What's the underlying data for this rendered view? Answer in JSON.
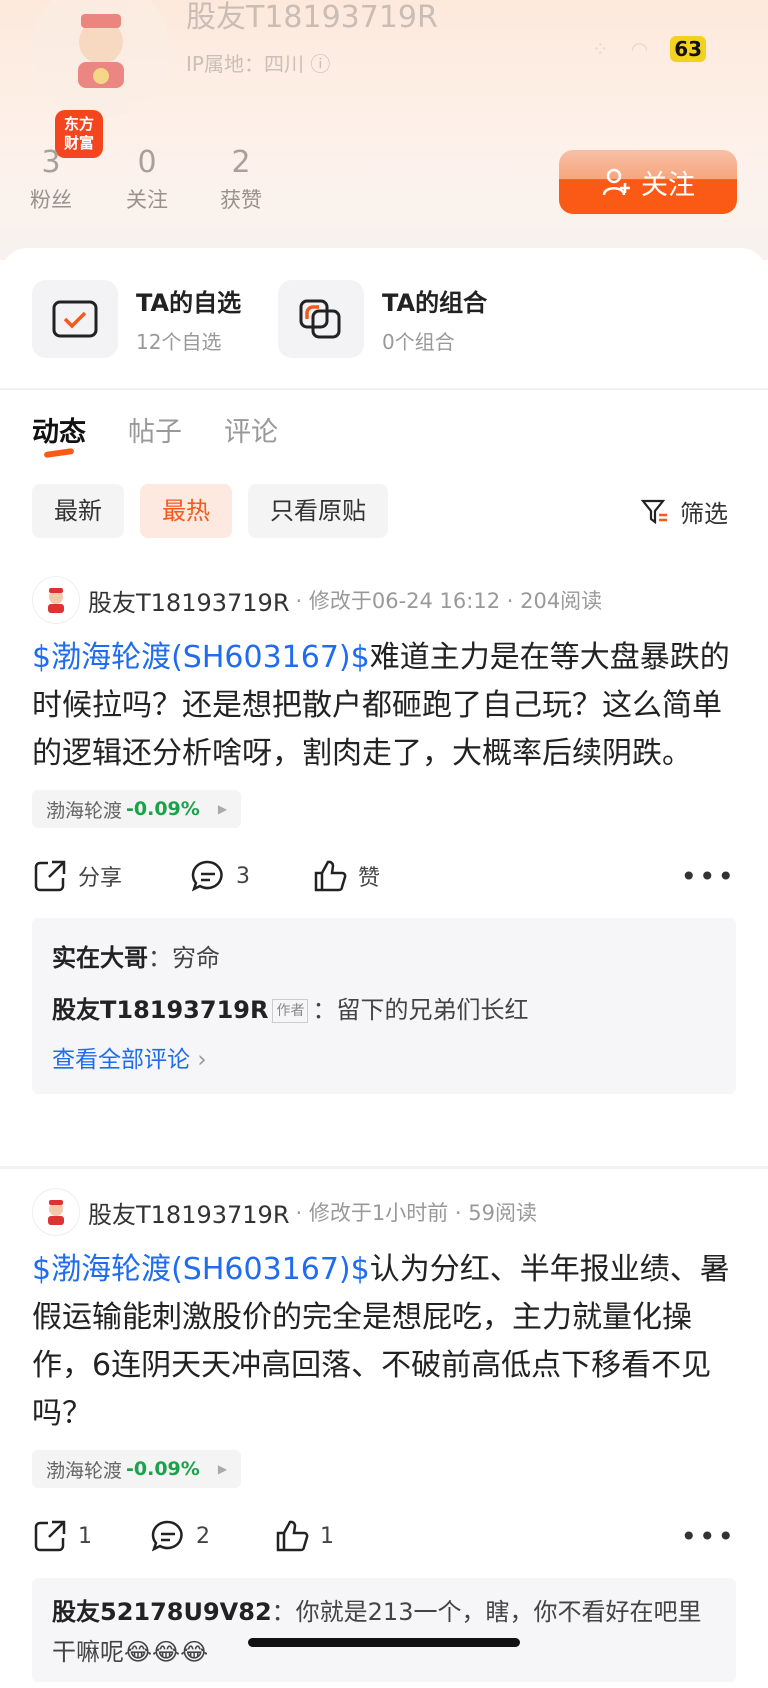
{
  "status_bar": {
    "battery": "63"
  },
  "profile": {
    "username": "股友T18193719R",
    "ip": "IP属地：四川",
    "app_badge": "东方财富",
    "stats": [
      {
        "num": "3",
        "label": "粉丝"
      },
      {
        "num": "0",
        "label": "关注"
      },
      {
        "num": "2",
        "label": "获赞"
      }
    ],
    "follow_label": "关注"
  },
  "quick": {
    "watchlist": {
      "title": "TA的自选",
      "sub": "12个自选"
    },
    "portfolio": {
      "title": "TA的组合",
      "sub": "0个组合"
    }
  },
  "tabs": [
    "动态",
    "帖子",
    "评论"
  ],
  "chips": [
    "最新",
    "最热",
    "只看原贴"
  ],
  "filter_label": "筛选",
  "posts": [
    {
      "author": "股友T18193719R",
      "meta": "· 修改于06-24 16:12 · 204阅读",
      "stock": "$渤海轮渡(SH603167)$",
      "text": "难道主力是在等大盘暴跌的时候拉吗？还是想把散户都砸跑了自己玩？这么简单的逻辑还分析啥呀，割肉走了，大概率后续阴跌。",
      "tag_name": "渤海轮渡",
      "tag_change": "-0.09%",
      "share": "分享",
      "comment_count": "3",
      "like": "赞",
      "comments": [
        {
          "name": "实在大哥",
          "text": "：穷命"
        },
        {
          "name": "股友T18193719R",
          "author_tag": "作者",
          "text": "：留下的兄弟们长红"
        }
      ],
      "view_all": "查看全部评论"
    },
    {
      "author": "股友T18193719R",
      "meta": "· 修改于1小时前 · 59阅读",
      "stock": "$渤海轮渡(SH603167)$",
      "text": "认为分红、半年报业绩、暑假运输能刺激股价的完全是想屁吃，主力就量化操作，6连阴天天冲高回落、不破前高低点下移看不见吗？",
      "tag_name": "渤海轮渡",
      "tag_change": "-0.09%",
      "share": "1",
      "comment_count": "2",
      "like": "1",
      "comments": [
        {
          "name": "股友52178U9V82",
          "text": "：你就是213一个，瞎，你不看好在吧里干嘛呢😂😂😂"
        }
      ]
    }
  ]
}
